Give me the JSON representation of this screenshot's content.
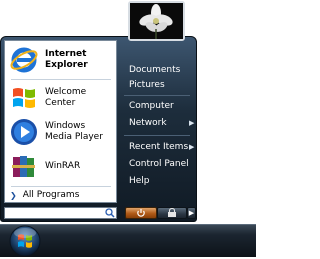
{
  "left_pane": {
    "programs": [
      {
        "name": "Internet Explorer",
        "lines": [
          "Internet",
          "Explorer"
        ],
        "bold": true,
        "icon": "internet-explorer-icon"
      },
      {
        "name": "Welcome Center",
        "lines": [
          "Welcome",
          "Center"
        ],
        "bold": false,
        "icon": "windows-logo-icon"
      },
      {
        "name": "Windows Media Player",
        "lines": [
          "Windows",
          "Media Player"
        ],
        "bold": false,
        "icon": "media-player-icon"
      },
      {
        "name": "WinRAR",
        "lines": [
          "WinRAR"
        ],
        "bold": false,
        "icon": "winrar-icon"
      }
    ],
    "all_programs_label": "All Programs"
  },
  "right_pane": {
    "items": [
      {
        "label": "Documents",
        "submenu": false
      },
      {
        "label": "Pictures",
        "submenu": false
      },
      {
        "label": "Computer",
        "submenu": false
      },
      {
        "label": "Network",
        "submenu": true
      },
      {
        "label": "Recent Items",
        "submenu": true
      },
      {
        "label": "Control Panel",
        "submenu": false
      },
      {
        "label": "Help",
        "submenu": false
      }
    ]
  },
  "search": {
    "value": "",
    "icon": "search-icon"
  },
  "bottom_buttons": {
    "power_icon": "power-icon",
    "lock_icon": "lock-icon",
    "arrow_icon": "arrow-right-icon"
  },
  "taskbar": {
    "start_orb_icon": "windows-orb-icon"
  },
  "colors": {
    "menu_dark": "#1d2d3c",
    "power_orange": "#b05a17",
    "text_white": "#ffffff"
  }
}
